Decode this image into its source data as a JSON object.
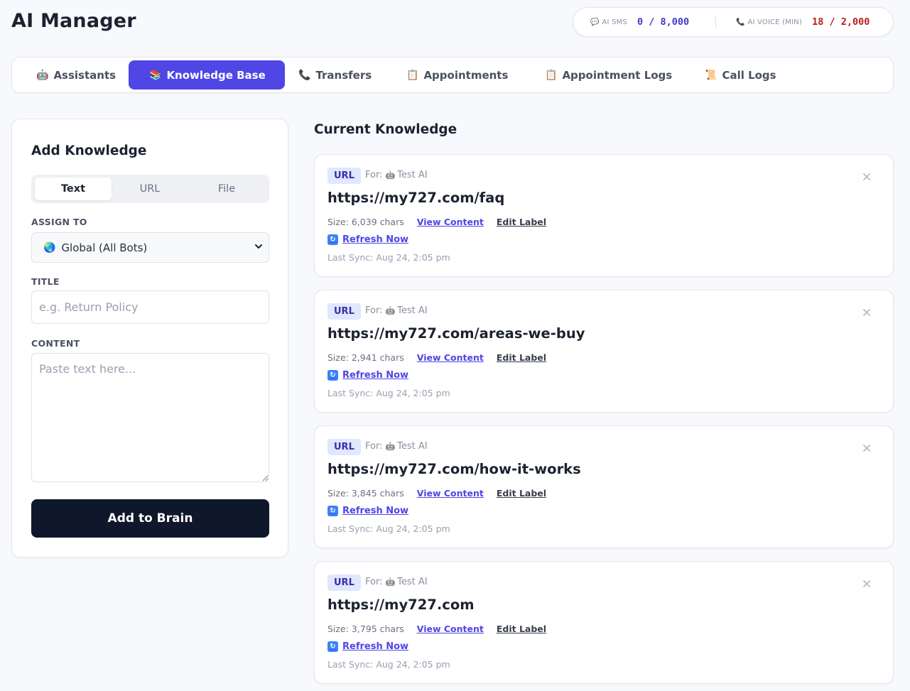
{
  "header": {
    "title": "AI Manager",
    "usage": {
      "sms": {
        "icon": "chat-bubble-icon",
        "label": "AI SMS",
        "value": "0 / 8,000",
        "color": "#4338ca"
      },
      "voice": {
        "icon": "phone-icon",
        "label": "AI VOICE (MIN)",
        "value": "18 / 2,000",
        "color": "#b91c1c"
      }
    }
  },
  "tabs": [
    {
      "icon": "robot-icon",
      "glyph": "🤖",
      "label": "Assistants",
      "active": false
    },
    {
      "icon": "books-icon",
      "glyph": "📚",
      "label": "Knowledge Base",
      "active": true
    },
    {
      "icon": "phone-icon",
      "glyph": "📞",
      "label": "Transfers",
      "active": false
    },
    {
      "icon": "clipboard-icon",
      "glyph": "📋",
      "label": "Appointments",
      "active": false
    },
    {
      "icon": "clipboard-icon",
      "glyph": "📋",
      "label": "Appointment Logs",
      "active": false
    },
    {
      "icon": "scroll-icon",
      "glyph": "📜",
      "label": "Call Logs",
      "active": false
    }
  ],
  "add_panel": {
    "title": "Add Knowledge",
    "source_types": [
      "Text",
      "URL",
      "File"
    ],
    "active_source": "Text",
    "assign_label": "ASSIGN TO",
    "assign_value": "Global (All Bots)",
    "title_label": "TITLE",
    "title_placeholder": "e.g. Return Policy",
    "content_label": "CONTENT",
    "content_placeholder": "Paste text here...",
    "submit_label": "Add to Brain"
  },
  "knowledge": {
    "title": "Current Knowledge",
    "for_label": "For:",
    "size_prefix": "Size:",
    "view_label": "View Content",
    "edit_label": "Edit Label",
    "refresh_label": "Refresh Now",
    "items": [
      {
        "type": "URL",
        "bot": "Test AI",
        "url": "https://my727.com/faq",
        "size": "6,039 chars",
        "last_sync": "Last Sync: Aug 24, 2:05 pm"
      },
      {
        "type": "URL",
        "bot": "Test AI",
        "url": "https://my727.com/areas-we-buy",
        "size": "2,941 chars",
        "last_sync": "Last Sync: Aug 24, 2:05 pm"
      },
      {
        "type": "URL",
        "bot": "Test AI",
        "url": "https://my727.com/how-it-works",
        "size": "3,845 chars",
        "last_sync": "Last Sync: Aug 24, 2:05 pm"
      },
      {
        "type": "URL",
        "bot": "Test AI",
        "url": "https://my727.com",
        "size": "3,795 chars",
        "last_sync": "Last Sync: Aug 24, 2:05 pm"
      }
    ]
  }
}
